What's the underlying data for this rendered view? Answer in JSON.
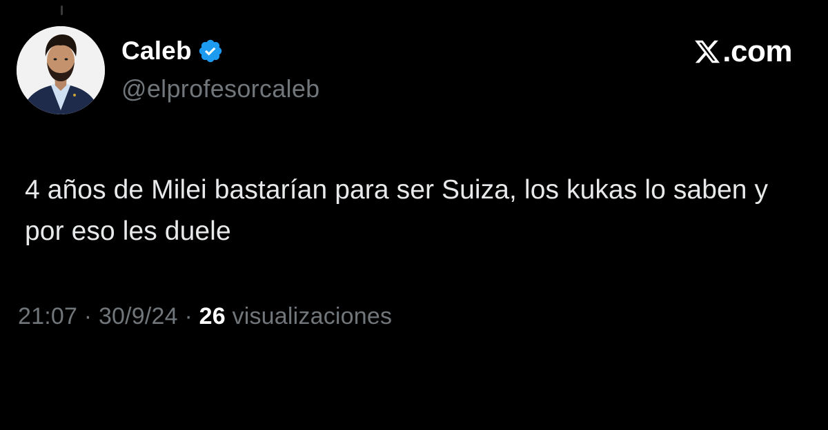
{
  "author": {
    "display_name": "Caleb",
    "handle": "@elprofesorcaleb",
    "verified": true,
    "verified_color": "#1d9bf0",
    "avatar_icon": "profile-photo"
  },
  "brand": {
    "label": ".com",
    "icon": "x-logo-icon"
  },
  "tweet": {
    "text": "4 años de Milei bastarían para ser Suiza, los kukas lo saben y por eso les duele"
  },
  "meta": {
    "time": "21:07",
    "separator": "·",
    "date": "30/9/24",
    "views_count": "26",
    "views_label": "visualizaciones"
  },
  "colors": {
    "background": "#000000",
    "primary_text": "#e7e9ea",
    "secondary_text": "#71767b",
    "accent": "#1d9bf0"
  }
}
